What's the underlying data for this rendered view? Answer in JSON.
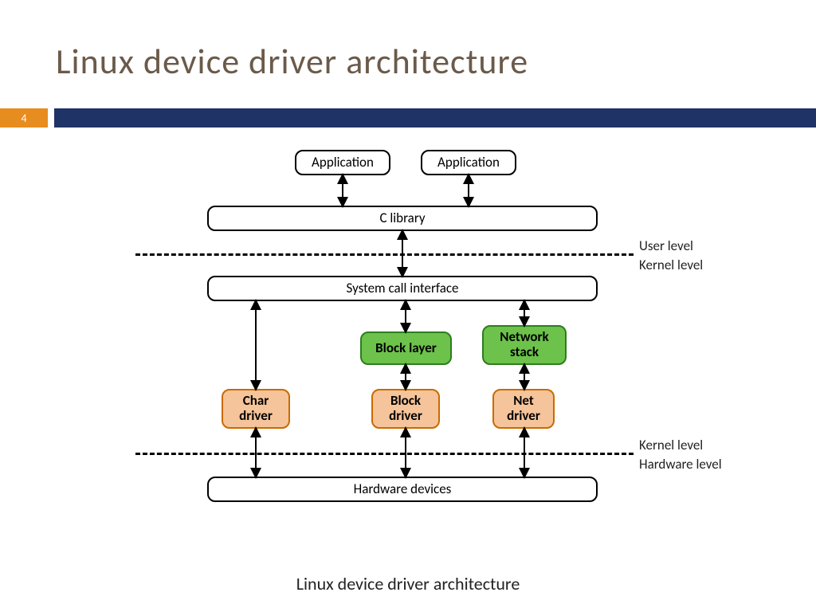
{
  "title": "Linux device driver architecture",
  "page_number": "4",
  "caption": "Linux device driver architecture",
  "boxes": {
    "app1": "Application",
    "app2": "Application",
    "clib": "C library",
    "syscall": "System call interface",
    "blocklayer": "Block layer",
    "netstack": "Network stack",
    "chardrv": "Char driver",
    "blockdrv": "Block driver",
    "netdrv": "Net driver",
    "hw": "Hardware devices"
  },
  "labels": {
    "user_level": "User level",
    "kernel_level_top": "Kernel level",
    "kernel_level_bottom": "Kernel level",
    "hardware_level": "Hardware level"
  }
}
